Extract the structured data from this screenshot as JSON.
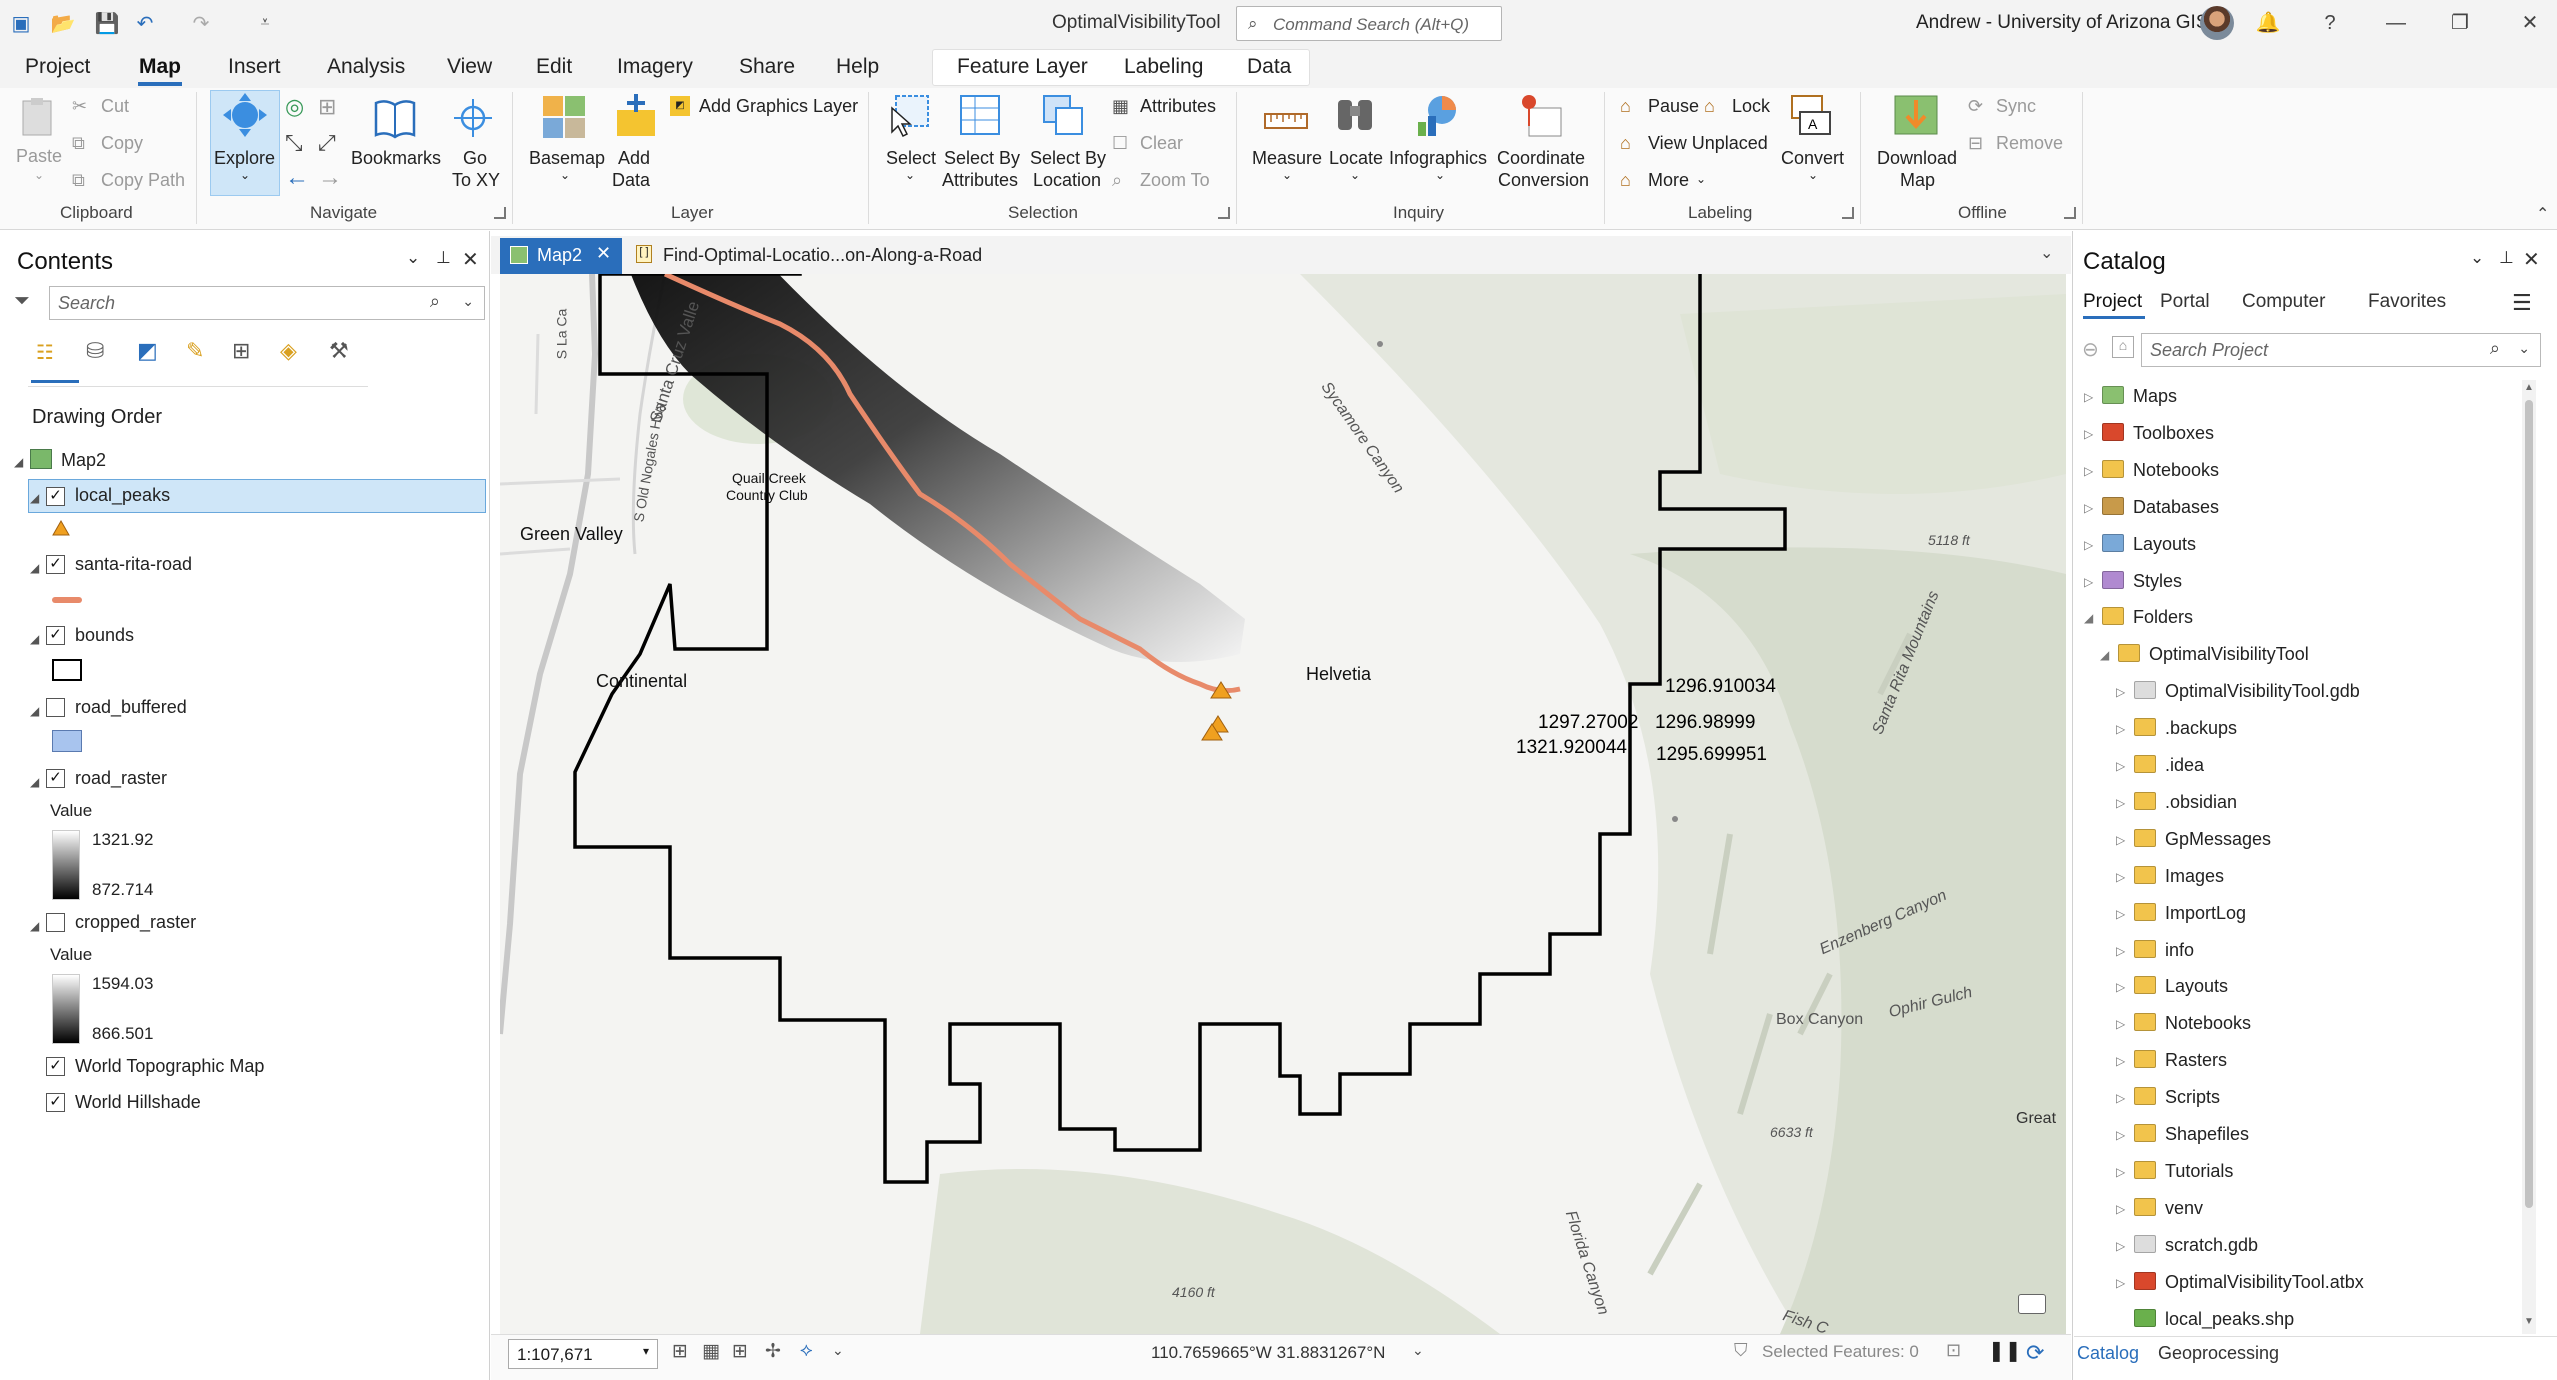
{
  "app": {
    "title": "OptimalVisibilityTool",
    "command_search_placeholder": "Command Search (Alt+Q)",
    "user": "Andrew - University of Arizona GIS",
    "window_controls": [
      "?",
      "—",
      "❐",
      "✕"
    ]
  },
  "menu_tabs": [
    "Project",
    "Map",
    "Insert",
    "Analysis",
    "View",
    "Edit",
    "Imagery",
    "Share",
    "Help"
  ],
  "active_tab": "Map",
  "context_tabs": [
    "Feature Layer",
    "Labeling",
    "Data"
  ],
  "ribbon": {
    "clipboard": {
      "paste": "Paste",
      "cut": "Cut",
      "copy": "Copy",
      "copy_path": "Copy Path",
      "group": "Clipboard"
    },
    "navigate": {
      "explore": "Explore",
      "bookmarks": "Bookmarks",
      "goto_line1": "Go",
      "goto_line2": "To XY",
      "group": "Navigate"
    },
    "layer": {
      "basemap": "Basemap",
      "add_data_line1": "Add",
      "add_data_line2": "Data",
      "add_graphics": "Add Graphics Layer",
      "group": "Layer"
    },
    "selection": {
      "select": "Select",
      "by_attr_line1": "Select By",
      "by_attr_line2": "Attributes",
      "by_loc_line1": "Select By",
      "by_loc_line2": "Location",
      "attributes": "Attributes",
      "clear": "Clear",
      "zoom_to": "Zoom To",
      "group": "Selection"
    },
    "inquiry": {
      "measure": "Measure",
      "locate": "Locate",
      "infographics": "Infographics",
      "coord_line1": "Coordinate",
      "coord_line2": "Conversion",
      "group": "Inquiry"
    },
    "labeling": {
      "pause": "Pause",
      "lock": "Lock",
      "view_unplaced": "View Unplaced",
      "more": "More",
      "convert": "Convert",
      "group": "Labeling"
    },
    "offline": {
      "download_line1": "Download",
      "download_line2": "Map",
      "sync": "Sync",
      "remove": "Remove",
      "group": "Offline"
    }
  },
  "contents": {
    "title": "Contents",
    "search_placeholder": "Search",
    "drawing_order": "Drawing Order",
    "map_name": "Map2",
    "layers": [
      {
        "name": "local_peaks",
        "checked": true
      },
      {
        "name": "santa-rita-road",
        "checked": true
      },
      {
        "name": "bounds",
        "checked": true
      },
      {
        "name": "road_buffered",
        "checked": false
      },
      {
        "name": "road_raster",
        "checked": true,
        "value_label": "Value",
        "high": "1321.92",
        "low": "872.714"
      },
      {
        "name": "cropped_raster",
        "checked": false,
        "value_label": "Value",
        "high": "1594.03",
        "low": "866.501"
      },
      {
        "name": "World Topographic Map",
        "checked": true
      },
      {
        "name": "World Hillshade",
        "checked": true
      }
    ]
  },
  "map_tabs": [
    {
      "label": "Map2",
      "active": true
    },
    {
      "label": "Find-Optimal-Locatio...on-Along-a-Road",
      "active": false
    }
  ],
  "map": {
    "place_labels": [
      "Green Valley",
      "Continental",
      "Helvetia",
      "Quail Creek",
      "Country Club"
    ],
    "road_labels": [
      "S La Ca",
      "Santa Cruz Valle",
      "S Old Nogales Hwy"
    ],
    "terrain_labels": [
      "Sycamore Canyon",
      "Santa Rita Mountains",
      "Box Canyon",
      "Enzenberg Canyon",
      "Ophir Gulch",
      "Florida Canyon",
      "Fish C",
      "Great"
    ],
    "elevation_labels": [
      "5118 ft",
      "6633 ft",
      "4160 ft"
    ],
    "peak_labels": [
      "1296.910034",
      "1297.27002",
      "1296.98999",
      "1321.920044",
      "1295.699951"
    ]
  },
  "status": {
    "scale": "1:107,671",
    "coordinates": "110.7659665°W 31.8831267°N",
    "selected_features": "Selected Features: 0"
  },
  "catalog": {
    "title": "Catalog",
    "tabs": [
      "Project",
      "Portal",
      "Computer",
      "Favorites"
    ],
    "search_placeholder": "Search Project",
    "items": [
      {
        "label": "Maps",
        "icon": "maps-icon",
        "level": 0,
        "expanded": false
      },
      {
        "label": "Toolboxes",
        "icon": "toolboxes-icon",
        "level": 0,
        "expanded": false
      },
      {
        "label": "Notebooks",
        "icon": "notebooks-icon",
        "level": 0,
        "expanded": false
      },
      {
        "label": "Databases",
        "icon": "databases-icon",
        "level": 0,
        "expanded": false
      },
      {
        "label": "Layouts",
        "icon": "layouts-icon",
        "level": 0,
        "expanded": false
      },
      {
        "label": "Styles",
        "icon": "styles-icon",
        "level": 0,
        "expanded": false
      },
      {
        "label": "Folders",
        "icon": "folders-icon",
        "level": 0,
        "expanded": true
      },
      {
        "label": "OptimalVisibilityTool",
        "icon": "folder-icon",
        "level": 1,
        "expanded": true
      },
      {
        "label": "OptimalVisibilityTool.gdb",
        "icon": "geodatabase-icon",
        "level": 2
      },
      {
        "label": ".backups",
        "icon": "folder-icon",
        "level": 2
      },
      {
        "label": ".idea",
        "icon": "folder-icon",
        "level": 2
      },
      {
        "label": ".obsidian",
        "icon": "folder-icon",
        "level": 2
      },
      {
        "label": "GpMessages",
        "icon": "folder-icon",
        "level": 2
      },
      {
        "label": "Images",
        "icon": "folder-icon",
        "level": 2
      },
      {
        "label": "ImportLog",
        "icon": "folder-icon",
        "level": 2
      },
      {
        "label": "info",
        "icon": "folder-icon",
        "level": 2
      },
      {
        "label": "Layouts",
        "icon": "folder-icon",
        "level": 2
      },
      {
        "label": "Notebooks",
        "icon": "folder-icon",
        "level": 2
      },
      {
        "label": "Rasters",
        "icon": "folder-icon",
        "level": 2
      },
      {
        "label": "Scripts",
        "icon": "folder-icon",
        "level": 2
      },
      {
        "label": "Shapefiles",
        "icon": "folder-icon",
        "level": 2
      },
      {
        "label": "Tutorials",
        "icon": "folder-icon",
        "level": 2
      },
      {
        "label": "venv",
        "icon": "folder-icon",
        "level": 2
      },
      {
        "label": "scratch.gdb",
        "icon": "database-icon",
        "level": 2
      },
      {
        "label": "OptimalVisibilityTool.atbx",
        "icon": "toolbox-icon",
        "level": 2
      },
      {
        "label": "local_peaks.shp",
        "icon": "shapefile-icon",
        "level": 2,
        "no_arrow": true
      }
    ],
    "bottom_tabs": [
      "Catalog",
      "Geoprocessing"
    ]
  },
  "colors": {
    "accent": "#2a6ebb",
    "road": "#e88a6a",
    "peak": "#f0a020",
    "selection": "#cfe6f8"
  }
}
